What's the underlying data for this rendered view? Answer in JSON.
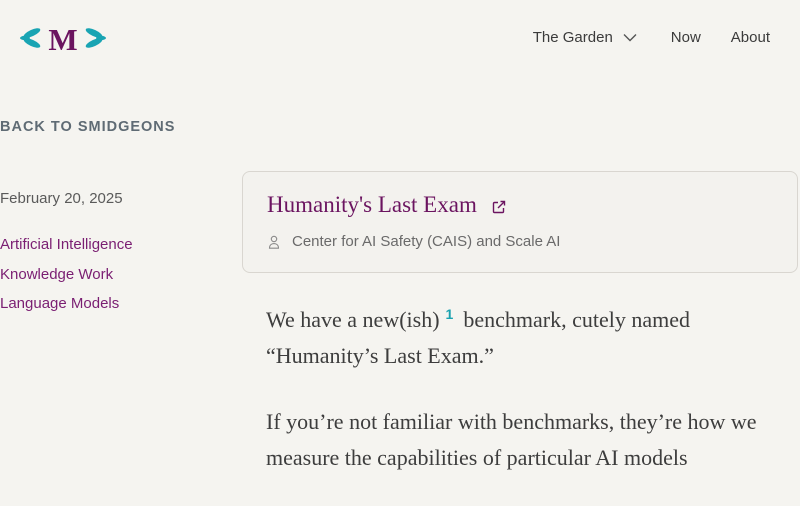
{
  "header": {
    "logo_letter": "M",
    "logo_icon": "leaf-logo-icon",
    "nav": [
      {
        "label": "The Garden",
        "has_dropdown": true
      },
      {
        "label": "Now"
      },
      {
        "label": "About"
      }
    ]
  },
  "back_link": "BACK TO SMIDGEONS",
  "meta": {
    "date": "February 20, 2025",
    "tags": [
      "Artificial Intelligence",
      "Knowledge Work",
      "Language Models"
    ]
  },
  "card": {
    "title": "Humanity's Last Exam",
    "external_icon": "external-link-icon",
    "author_icon": "person-icon",
    "author": "Center for AI Safety (CAIS) and Scale AI"
  },
  "body": {
    "p1_before": "We have a new(ish)",
    "footnote": "1",
    "p1_after": "benchmark, cutely named “Humanity’s Last Exam.”",
    "p2": "If you’re not familiar with benchmarks, they’re how we measure the capabilities of particular AI models"
  },
  "colors": {
    "background": "#f5f4f0",
    "accent_purple": "#6b1460",
    "tag_purple": "#7a1e72",
    "teal": "#1aa2b0"
  }
}
